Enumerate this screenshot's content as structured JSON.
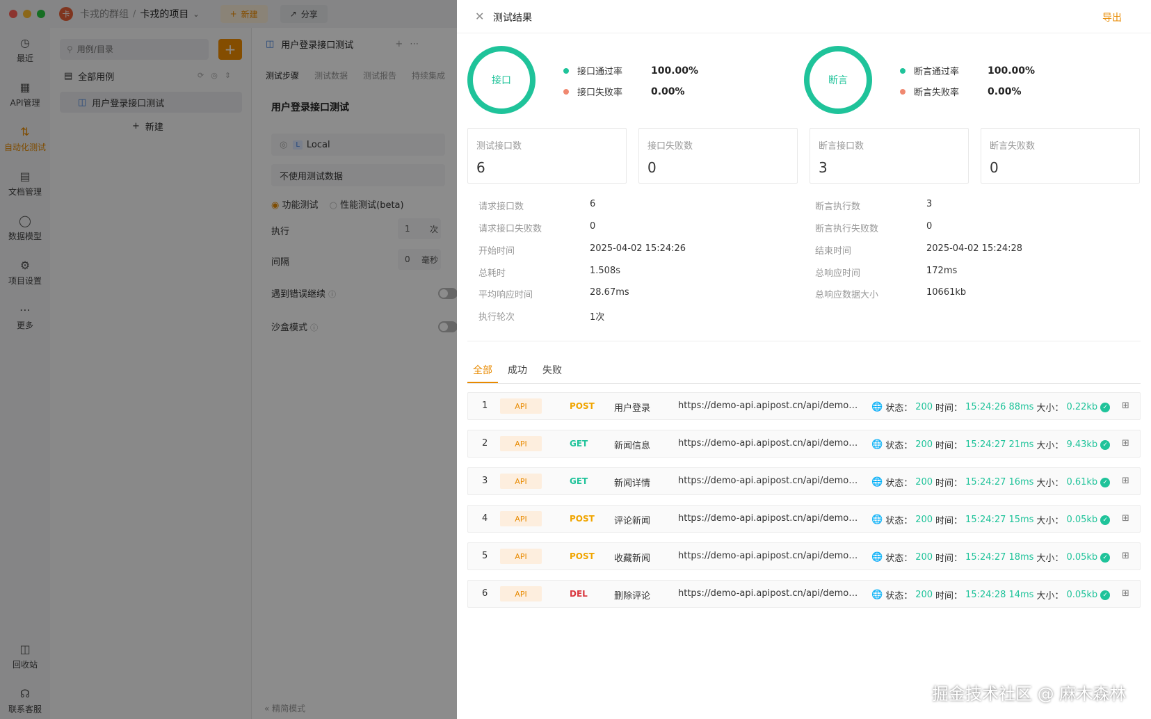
{
  "titlebar": {
    "team": "卡戎的群组",
    "separator": "/",
    "project": "卡戎的项目",
    "new_label": "新建",
    "share_label": "分享"
  },
  "nav": {
    "items": [
      {
        "label": "最近",
        "icon": "clock-icon"
      },
      {
        "label": "API管理",
        "icon": "api-icon"
      },
      {
        "label": "自动化测试",
        "icon": "automation-icon"
      },
      {
        "label": "文档管理",
        "icon": "document-icon"
      },
      {
        "label": "数据模型",
        "icon": "data-model-icon"
      },
      {
        "label": "项目设置",
        "icon": "settings-icon"
      },
      {
        "label": "更多",
        "icon": "more-icon"
      }
    ],
    "bottom": [
      {
        "label": "回收站",
        "icon": "trash-icon"
      },
      {
        "label": "联系客服",
        "icon": "headset-icon"
      }
    ]
  },
  "tree": {
    "search_placeholder": "用例/目录",
    "root": "全部用例",
    "case": "用户登录接口测试",
    "new_label": "新建"
  },
  "editor": {
    "tab": "用户登录接口测试",
    "subtabs": [
      "测试步骤",
      "测试数据",
      "测试报告",
      "持续集成"
    ],
    "title": "用户登录接口测试",
    "env": "Local",
    "env_badge": "L",
    "dataset": "不使用测试数据",
    "mode_functional": "功能测试",
    "mode_perf": "性能测试(beta)",
    "exec_label": "执行",
    "exec_value": "1",
    "exec_unit": "次",
    "interval_label": "间隔",
    "interval_value": "0",
    "interval_unit": "毫秒",
    "continue_on_error": "遇到错误继续",
    "sandbox": "沙盒模式",
    "simple_mode": "精简模式"
  },
  "drawer": {
    "title": "测试结果",
    "export": "导出",
    "api_ring": {
      "label": "接口",
      "pass_label": "接口通过率",
      "pass_value": "100.00%",
      "fail_label": "接口失败率",
      "fail_value": "0.00%"
    },
    "assert_ring": {
      "label": "断言",
      "pass_label": "断言通过率",
      "pass_value": "100.00%",
      "fail_label": "断言失败率",
      "fail_value": "0.00%"
    },
    "cards": [
      {
        "label": "测试接口数",
        "value": "6"
      },
      {
        "label": "接口失败数",
        "value": "0"
      },
      {
        "label": "断言接口数",
        "value": "3"
      },
      {
        "label": "断言失败数",
        "value": "0"
      }
    ],
    "stats_left": [
      {
        "label": "请求接口数",
        "value": "6"
      },
      {
        "label": "请求接口失败数",
        "value": "0"
      },
      {
        "label": "开始时间",
        "value": "2025-04-02 15:24:26"
      },
      {
        "label": "总耗时",
        "value": "1.508s"
      },
      {
        "label": "平均响应时间",
        "value": "28.67ms"
      },
      {
        "label": "执行轮次",
        "value": "1次"
      }
    ],
    "stats_right": [
      {
        "label": "断言执行数",
        "value": "3"
      },
      {
        "label": "断言执行失败数",
        "value": "0"
      },
      {
        "label": "结束时间",
        "value": "2025-04-02 15:24:28"
      },
      {
        "label": "总响应时间",
        "value": "172ms"
      },
      {
        "label": "总响应数据大小",
        "value": "10661kb"
      }
    ],
    "tabs": [
      "全部",
      "成功",
      "失败"
    ],
    "status_label": "状态：",
    "time_label": "时间：",
    "size_label": "大小：",
    "rows": [
      {
        "idx": "1",
        "badge": "API",
        "method": "POST",
        "name": "用户登录",
        "url": "https://demo-api.apipost.cn/api/demo/...",
        "status": "200",
        "time": "15:24:26",
        "duration": "88ms",
        "size": "0.22kb"
      },
      {
        "idx": "2",
        "badge": "API",
        "method": "GET",
        "name": "新闻信息",
        "url": "https://demo-api.apipost.cn/api/demo/...",
        "status": "200",
        "time": "15:24:27",
        "duration": "21ms",
        "size": "9.43kb"
      },
      {
        "idx": "3",
        "badge": "API",
        "method": "GET",
        "name": "新闻详情",
        "url": "https://demo-api.apipost.cn/api/demo/...",
        "status": "200",
        "time": "15:24:27",
        "duration": "16ms",
        "size": "0.61kb"
      },
      {
        "idx": "4",
        "badge": "API",
        "method": "POST",
        "name": "评论新闻",
        "url": "https://demo-api.apipost.cn/api/demo/...",
        "status": "200",
        "time": "15:24:27",
        "duration": "15ms",
        "size": "0.05kb"
      },
      {
        "idx": "5",
        "badge": "API",
        "method": "POST",
        "name": "收藏新闻",
        "url": "https://demo-api.apipost.cn/api/demo/...",
        "status": "200",
        "time": "15:24:27",
        "duration": "18ms",
        "size": "0.05kb"
      },
      {
        "idx": "6",
        "badge": "API",
        "method": "DEL",
        "name": "删除评论",
        "url": "https://demo-api.apipost.cn/api/demo/...",
        "status": "200",
        "time": "15:24:28",
        "duration": "14ms",
        "size": "0.05kb"
      }
    ]
  },
  "watermark": "掘金技术社区 @ 麻木森林",
  "colors": {
    "accent": "#e88a00",
    "success": "#1fc39a",
    "fail": "#f08870",
    "delete": "#d9363e",
    "post": "#f0a500"
  }
}
